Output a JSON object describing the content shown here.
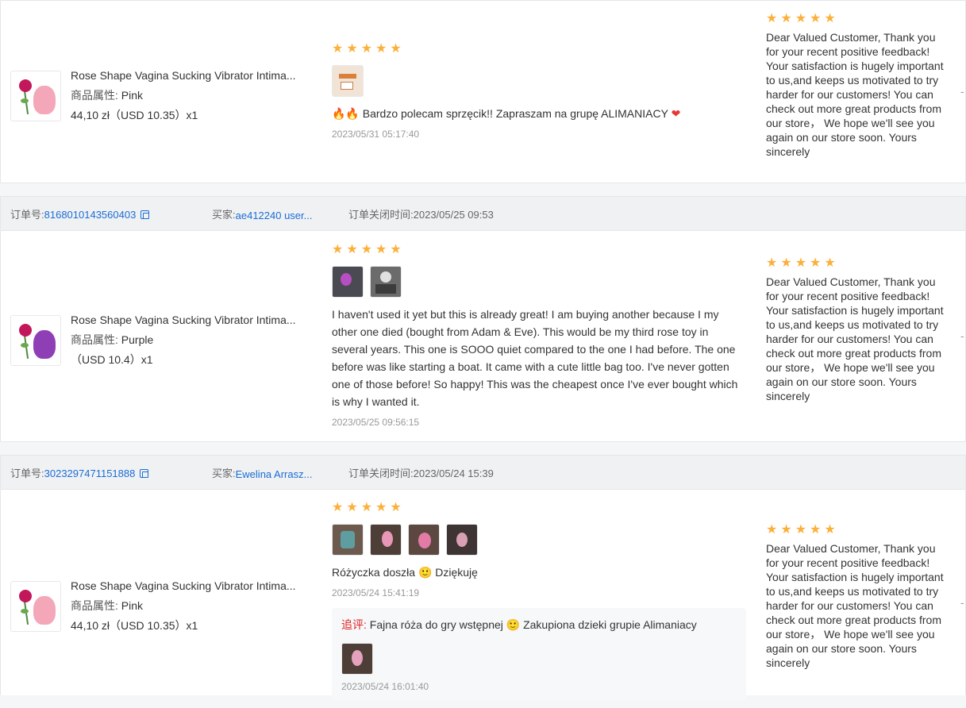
{
  "labels": {
    "order_no": "订单号:",
    "buyer": "买家:",
    "closed_time": "订单关闭时间:",
    "attr": "商品属性:",
    "followup": "追评:",
    "dash": "-"
  },
  "colors": {
    "star": "#fbb03b",
    "link": "#1a6dd6",
    "followup_label": "#e02020"
  },
  "reviews": [
    {
      "product_name": "Rose Shape Vagina Sucking Vibrator Intima...",
      "attr_value": "Pink",
      "price": "44,10 zł（USD  10.35）x1",
      "stars": 5,
      "review_text": "Bardzo polecam sprzęcik!! Zapraszam na grupę ALIMANIACY",
      "review_time": "2023/05/31 05:17:40",
      "reply_stars": 5,
      "reply_text": "Dear Valued Customer, Thank you for your recent positive feedback! Your satisfaction is hugely important to us,and keeps us motivated to try harder for our customers! You can check out more great products from our store，  We hope we'll see you again on our store soon. Yours sincerely"
    },
    {
      "order_no": "8168010143560403",
      "buyer": "ae412240 user...",
      "closed_time": "2023/05/25 09:53",
      "product_name": "Rose Shape Vagina Sucking Vibrator Intima...",
      "attr_value": "Purple",
      "price": "（USD  10.4）x1",
      "stars": 5,
      "review_text": "I haven't used it yet but this is already great! I am buying another because I my other one died (bought from Adam & Eve). This would be my third rose toy in several years. This one is SOOO quiet compared to the one I had before. The one before was like starting a boat. It came with a cute little bag too. I've never gotten one of those before! So happy! This was the cheapest once I've ever bought which is why I wanted it.",
      "review_time": "2023/05/25 09:56:15",
      "reply_stars": 5,
      "reply_text": "Dear Valued Customer, Thank you for your recent positive feedback! Your satisfaction is hugely important to us,and keeps us motivated to try harder for our customers! You can check out more great products from our store，  We hope we'll see you again on our store soon. Yours sincerely"
    },
    {
      "order_no": "3023297471151888",
      "buyer": "Ewelina Arrasz...",
      "closed_time": "2023/05/24 15:39",
      "product_name": "Rose Shape Vagina Sucking Vibrator Intima...",
      "attr_value": "Pink",
      "price": "44,10 zł（USD  10.35）x1",
      "stars": 5,
      "review_text_a": "Różyczka doszła",
      "review_text_b": "Dziękuję",
      "review_time": "2023/05/24 15:41:19",
      "followup_text_a": "Fajna róża do gry wstępnej",
      "followup_text_b": "Zakupiona dzieki grupie Alimaniacy",
      "followup_time": "2023/05/24 16:01:40",
      "reply_stars": 5,
      "reply_text": "Dear Valued Customer, Thank you for your recent positive feedback! Your satisfaction is hugely important to us,and keeps us motivated to try harder for our customers! You can check out more great products from our store，  We hope we'll see you again on our store soon. Yours sincerely"
    }
  ]
}
